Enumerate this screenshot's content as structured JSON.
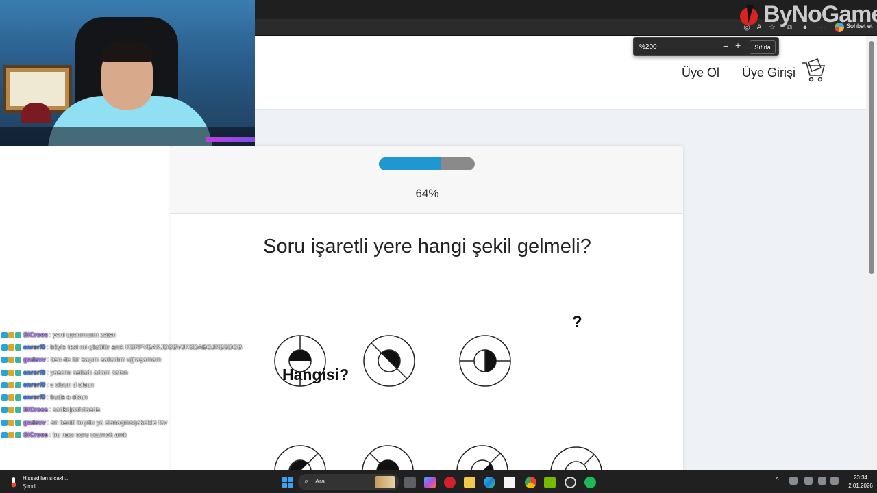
{
  "brand": {
    "name": "ByNoGame"
  },
  "browser": {
    "zoom": {
      "level": "%200",
      "reset_label": "Sıfırla",
      "minus": "−",
      "plus": "+"
    },
    "chat_button": "Sohbet et"
  },
  "site": {
    "nav": {
      "signup": "Üye Ol",
      "login": "Üye Girişi"
    }
  },
  "quiz": {
    "progress_percent": 64,
    "progress_text": "64%",
    "question": "Soru işaretli yere hangi şekil gelmeli?",
    "missing_marker": "?",
    "options_label": "Hangisi?"
  },
  "chat": {
    "messages": [
      {
        "user": "SlCroes",
        "color": "#b07cff",
        "text": ": yeni uyanmısım zaten"
      },
      {
        "user": "enrerf0",
        "color": "#3d7bff",
        "text": ": böyle test mi çözülür amk KSRFVBAKJDSBVJKSDABGJKBSDGB"
      },
      {
        "user": "gxdevv",
        "color": "#b07cff",
        "text": ": ben de bir kaçını salladım uğraşamam"
      },
      {
        "user": "enrerf0",
        "color": "#3d7bff",
        "text": ": yasemı salladı adam zaten"
      },
      {
        "user": "enrerf0",
        "color": "#3d7bff",
        "text": ": c olsun d olsun"
      },
      {
        "user": "enrerf0",
        "color": "#3d7bff",
        "text": ": buda a olsun"
      },
      {
        "user": "SlCroes",
        "color": "#b07cff",
        "text": ": sadkdjashdasda"
      },
      {
        "user": "gxdevv",
        "color": "#b07cff",
        "text": ": en basiti buydu ya slanagmsqakelxle fav"
      },
      {
        "user": "SlCroes",
        "color": "#b07cff",
        "text": ": bu nası soru cozmek amk"
      }
    ]
  },
  "taskbar": {
    "weather_title": "Hissedilen sıcaklı...",
    "weather_sub": "Şimdi",
    "search_label": "Ara",
    "time": "23:34",
    "date": "2.01.2026"
  }
}
